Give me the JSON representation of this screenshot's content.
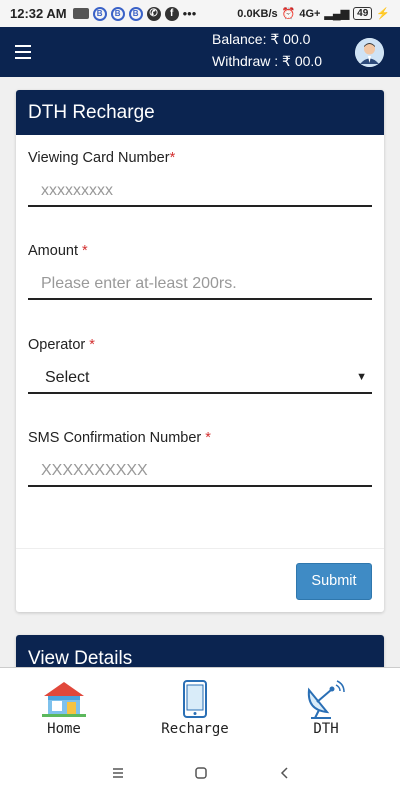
{
  "status_bar": {
    "time": "12:32 AM",
    "data_rate": "0.0KB/s",
    "network": "4G+",
    "battery": "49"
  },
  "header": {
    "balance_label": "Balance:",
    "balance_value": "₹ 00.0",
    "withdraw_label": "Withdraw :",
    "withdraw_value": "₹ 00.0"
  },
  "form": {
    "title": "DTH Recharge",
    "fields": [
      {
        "label": "Viewing Card Number",
        "required_mark": "*",
        "placeholder": "xxxxxxxxx"
      },
      {
        "label": "Amount ",
        "required_mark": "*",
        "placeholder": "Please enter at-least 200rs."
      },
      {
        "label": "Operator ",
        "required_mark": "*",
        "selected": "Select"
      },
      {
        "label": "SMS Confirmation Number ",
        "required_mark": "*",
        "placeholder": "XXXXXXXXXX"
      }
    ],
    "submit_label": "Submit"
  },
  "view_details": {
    "title": "View Details"
  },
  "bottom_nav": {
    "items": [
      {
        "label": "Home",
        "icon": "home-icon"
      },
      {
        "label": "Recharge",
        "icon": "mobile-phone-icon"
      },
      {
        "label": "DTH",
        "icon": "satellite-dish-icon"
      }
    ]
  },
  "colors": {
    "header": "#0b2450",
    "button": "#3f8bc5",
    "required": "#d32f2f"
  }
}
